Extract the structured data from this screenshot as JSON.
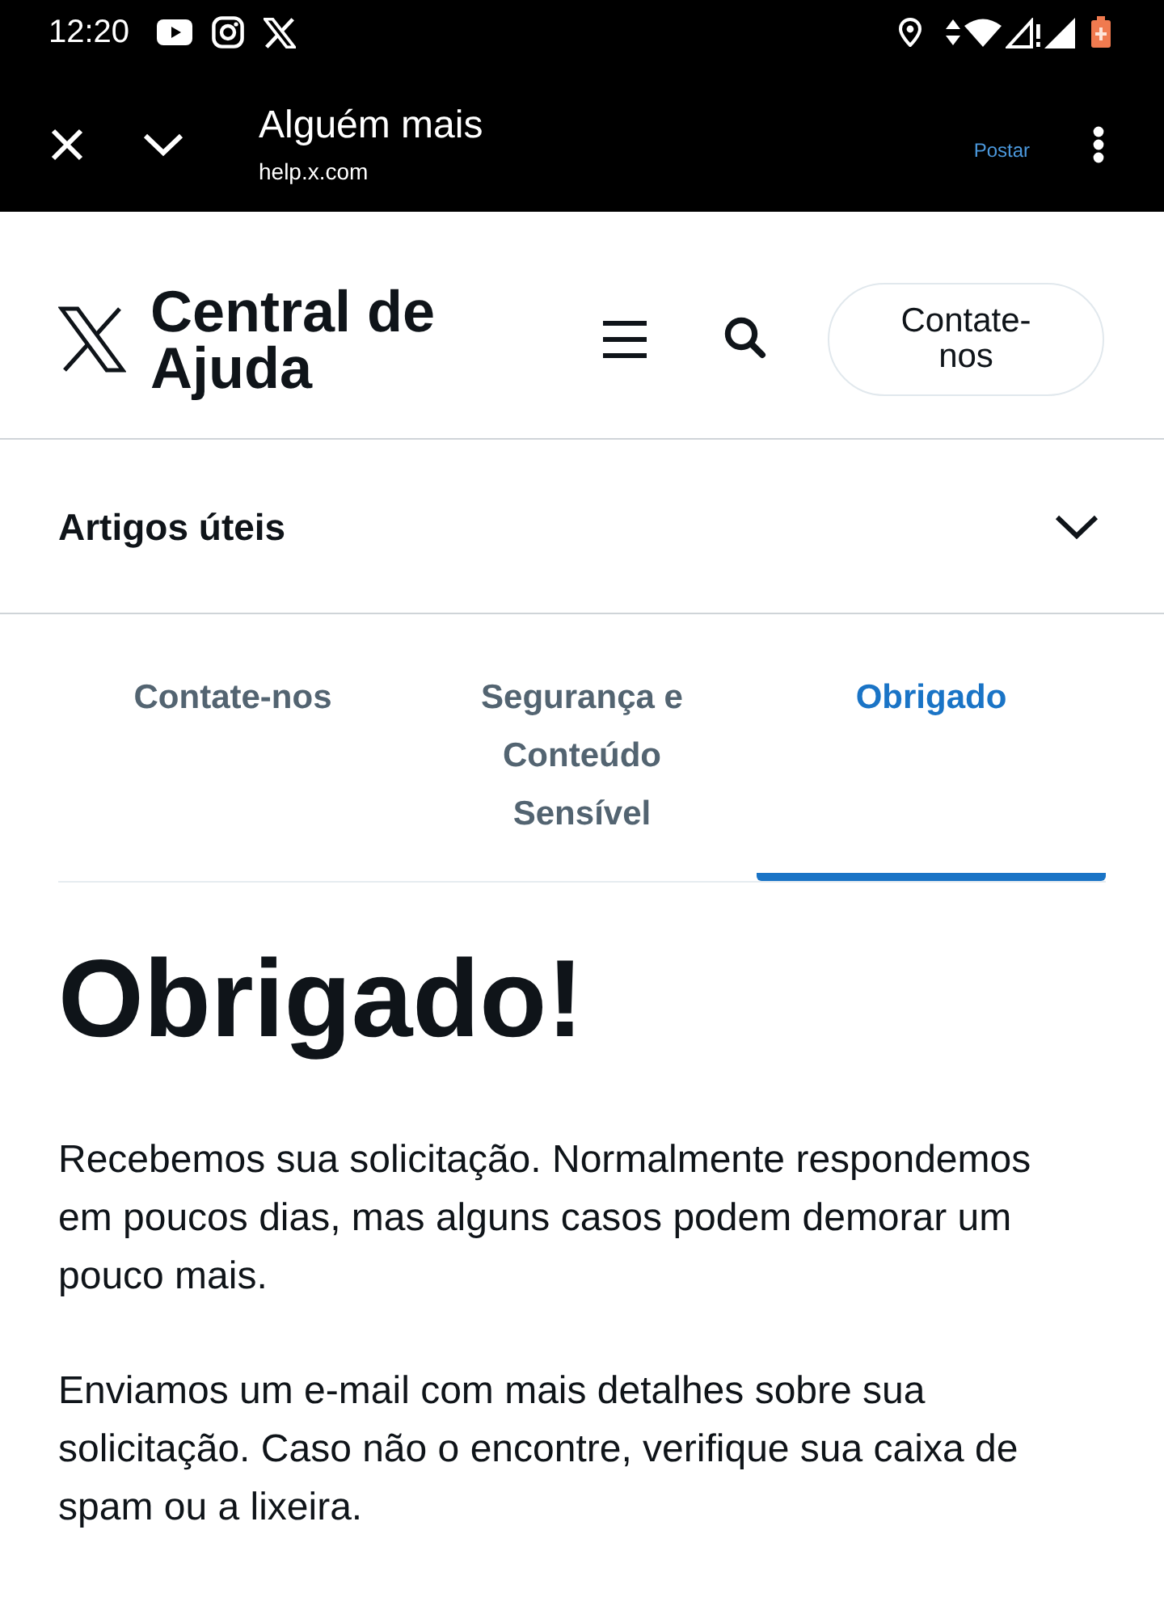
{
  "status_bar": {
    "time": "12:20"
  },
  "browser_bar": {
    "title": "Alguém mais",
    "url": "help.x.com",
    "action": "Postar"
  },
  "header": {
    "title": "Central de Ajuda",
    "contact_button": "Contate-nos"
  },
  "accordion": {
    "label": "Artigos úteis",
    "expanded": false
  },
  "tabs": [
    {
      "label": "Contate-nos",
      "selected": false
    },
    {
      "label": "Segurança e Conteúdo Sensível",
      "selected": false
    },
    {
      "label": "Obrigado",
      "selected": true
    }
  ],
  "article": {
    "heading": "Obrigado!",
    "paragraphs": [
      "Recebemos sua solicitação. Normalmente respondemos em poucos dias, mas alguns casos podem demorar um pouco mais.",
      "Enviamos um e-mail com mais detalhes sobre sua solicitação. Caso não o encontre, verifique sua caixa de spam ou a lixeira."
    ]
  }
}
